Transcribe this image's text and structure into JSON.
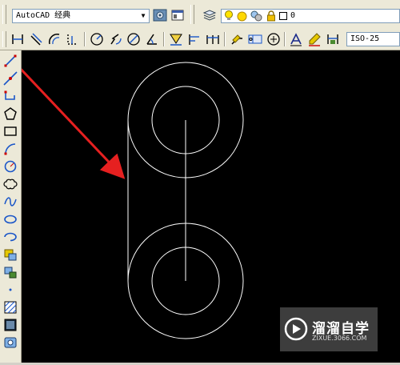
{
  "toolbar1": {
    "workspace_combo": "AutoCAD 经典",
    "layer_combo": "0"
  },
  "toolbar2": {
    "dimstyle_combo": "ISO-25"
  },
  "watermark": {
    "title": "溜溜自学",
    "url": "ZIXUE.3066.COM"
  },
  "colors": {
    "canvas": "#000000",
    "geometry": "#ffffff",
    "arrow": "#e62020",
    "toolbar": "#ece9d8"
  },
  "icons": {
    "toolbar1": [
      "settings-icon",
      "workspace-icon",
      "layer-properties-icon",
      "lightbulb-icon",
      "sun-icon",
      "freeze-icon",
      "lock-icon",
      "color-square-icon"
    ],
    "toolbar2": [
      "linear-dim-icon",
      "aligned-dim-icon",
      "arc-length-icon",
      "ordinate-dim-icon",
      "radius-icon",
      "jogged-icon",
      "diameter-icon",
      "angular-icon",
      "quick-dim-icon",
      "baseline-icon",
      "continue-icon",
      "quick-leader-icon",
      "tolerance-icon",
      "center-mark-icon",
      "dimension-edit-icon",
      "dimtext-edit-icon",
      "dim-update-icon"
    ],
    "sidebar": [
      "line-icon",
      "construction-line-icon",
      "polyline-icon",
      "polygon-icon",
      "rectangle-icon",
      "arc-icon",
      "circle-icon",
      "revision-cloud-icon",
      "spline-icon",
      "ellipse-icon",
      "ellipse-arc-icon",
      "insert-block-icon",
      "make-block-icon",
      "point-icon",
      "hatch-icon",
      "gradient-icon",
      "region-icon"
    ]
  }
}
